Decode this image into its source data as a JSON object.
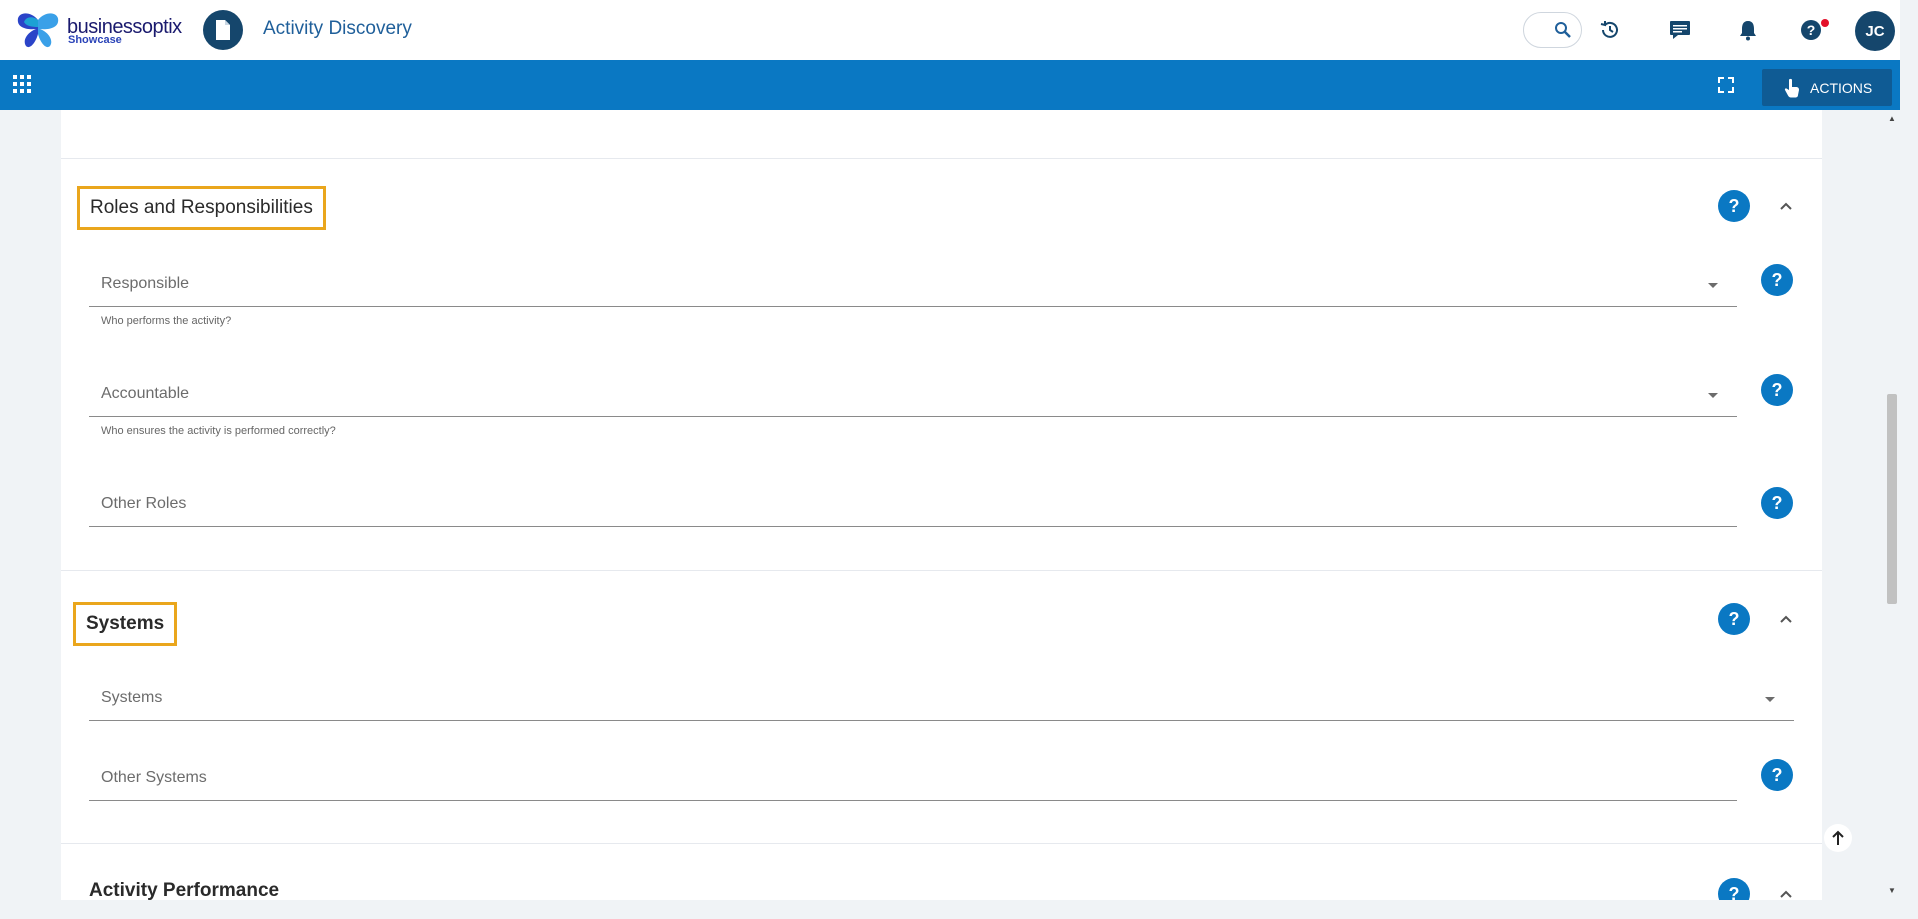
{
  "header": {
    "brand_name": "businessoptix",
    "brand_sub": "Showcase",
    "app_title": "Activity Discovery",
    "user_initials": "JC",
    "icons": [
      "search-icon",
      "history-icon",
      "comments-icon",
      "bell-icon",
      "help-icon"
    ]
  },
  "toolbar": {
    "actions_label": "ACTIONS"
  },
  "sections": {
    "roles": {
      "title": "Roles and Responsibilities",
      "fields": {
        "responsible": {
          "label": "Responsible",
          "hint": "Who performs the activity?"
        },
        "accountable": {
          "label": "Accountable",
          "hint": "Who ensures the activity is performed correctly?"
        },
        "other_roles": {
          "label": "Other Roles"
        }
      }
    },
    "systems": {
      "title": "Systems",
      "fields": {
        "systems": {
          "label": "Systems"
        },
        "other_systems": {
          "label": "Other Systems"
        }
      }
    },
    "performance": {
      "title": "Activity Performance"
    }
  },
  "help_glyph": "?",
  "colors": {
    "primary": "#0a78c3",
    "dark_navy": "#15466c",
    "highlight": "#eaa61c",
    "notification": "#e3102a"
  }
}
